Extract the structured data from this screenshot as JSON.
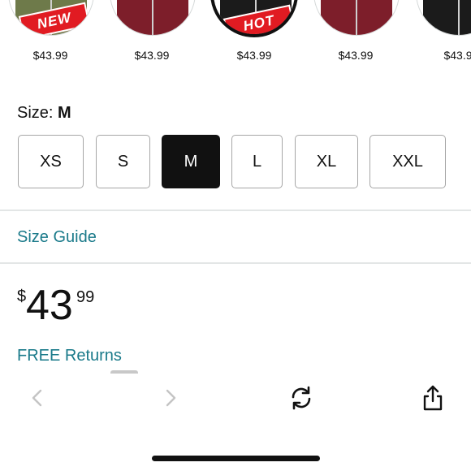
{
  "variants": [
    {
      "price": "$43.99",
      "color": "olive",
      "badge": "NEW"
    },
    {
      "price": "$43.99",
      "color": "wine",
      "badge": ""
    },
    {
      "price": "$43.99",
      "color": "black",
      "badge": "HOT",
      "selected": true
    },
    {
      "price": "$43.99",
      "color": "wine",
      "badge": ""
    },
    {
      "price": "$43.9",
      "color": "black",
      "badge": ""
    }
  ],
  "size": {
    "label": "Size:",
    "selected": "M",
    "options": [
      "XS",
      "S",
      "M",
      "L",
      "XL",
      "XXL"
    ]
  },
  "size_guide_label": "Size Guide",
  "price": {
    "symbol": "$",
    "whole": "43",
    "fraction": "99"
  },
  "free_returns_label": "FREE Returns",
  "toolbar": {
    "back_icon": "chevron-left-icon",
    "forward_icon": "chevron-right-icon",
    "refresh_icon": "refresh-icon",
    "share_icon": "share-icon"
  },
  "colors": {
    "accent_teal": "#1a7a8a",
    "badge_red": "#e11b22",
    "selected_bg": "#111111"
  }
}
